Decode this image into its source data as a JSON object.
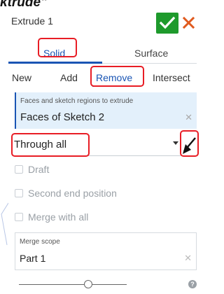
{
  "page": {
    "heading": "ktrude\""
  },
  "header": {
    "title": "Extrude 1",
    "accept_icon": "check-icon",
    "cancel_icon": "close-icon",
    "accept_color": "#1e9a2c",
    "cancel_color": "#e05a1e"
  },
  "tabs": {
    "solid": "Solid",
    "surface": "Surface",
    "active": "Solid"
  },
  "operations": {
    "new": "New",
    "add": "Add",
    "remove": "Remove",
    "intersect": "Intersect",
    "active": "Remove"
  },
  "faces": {
    "label": "Faces and sketch regions to extrude",
    "value": "Faces of Sketch 2",
    "clear_icon": "close-icon"
  },
  "end_type": {
    "value": "Through all",
    "flip_icon": "flip-direction-icon"
  },
  "options": {
    "draft": "Draft",
    "second_end": "Second end position",
    "merge_all": "Merge with all"
  },
  "merge_scope": {
    "label": "Merge scope",
    "value": "Part 1",
    "clear_icon": "close-icon"
  },
  "footer": {
    "slider_value": 0.6,
    "help_icon": "help-icon",
    "help_glyph": "?"
  },
  "colors": {
    "accent": "#1a55b4",
    "highlight": "#e81d25",
    "field_bg": "#e3f0fb"
  }
}
